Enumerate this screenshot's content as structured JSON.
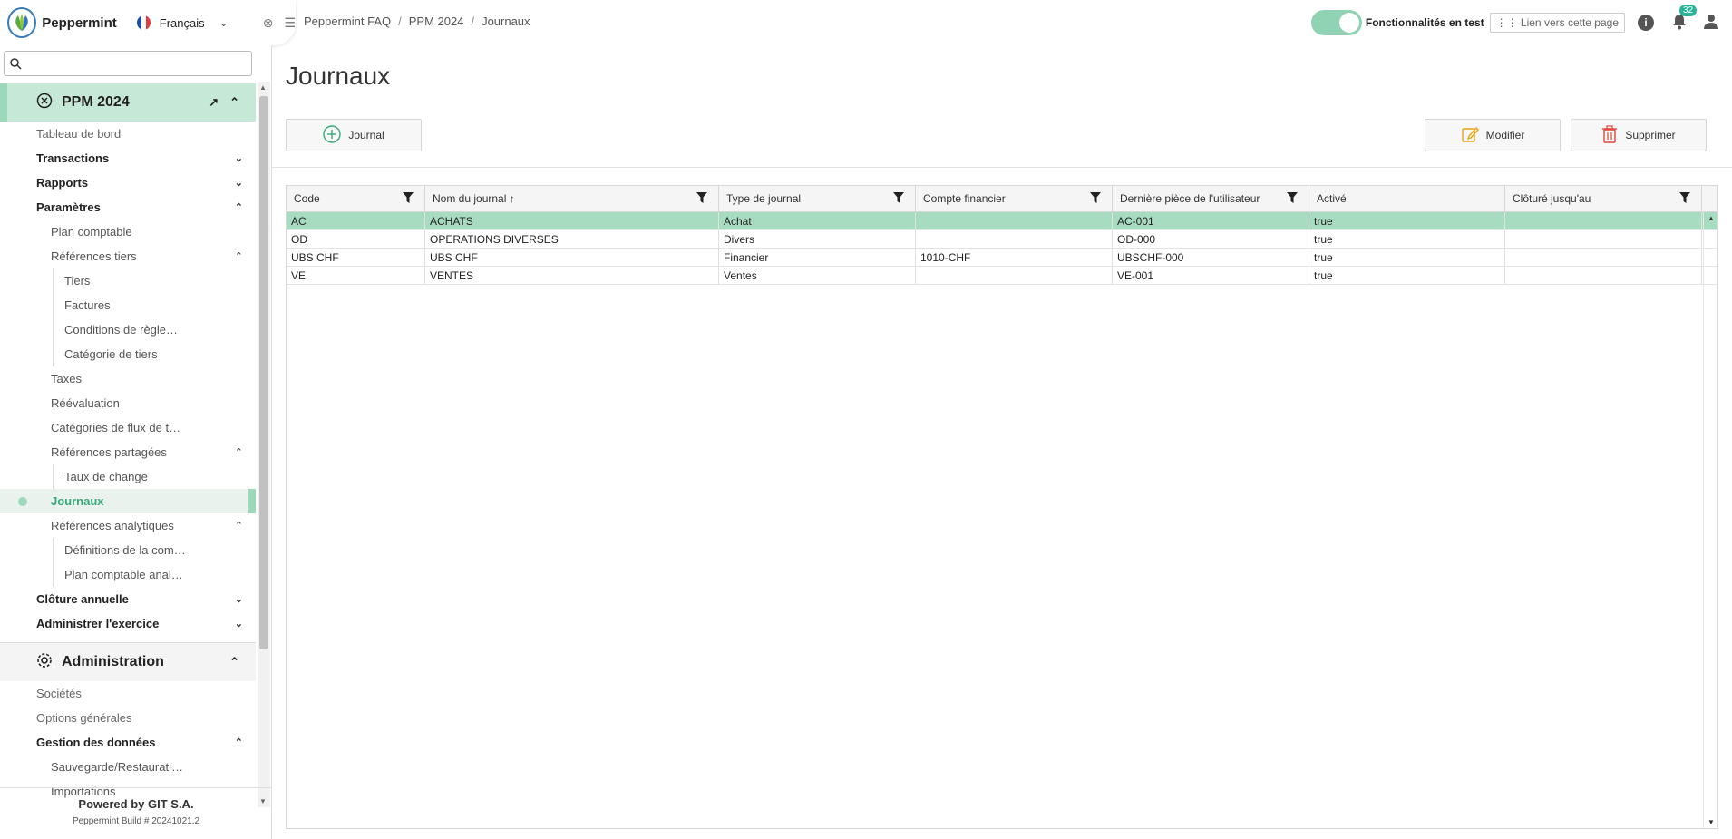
{
  "topbar": {
    "brand": "Peppermint",
    "language": "Français",
    "breadcrumbs": [
      "Peppermint FAQ",
      "PPM 2024",
      "Journaux"
    ],
    "feature_toggle_label": "Fonctionnalités en test",
    "link_button": "Lien vers cette page",
    "info_label": "i",
    "notifications_count": "32"
  },
  "sidebar": {
    "search_placeholder": "",
    "project_title": "PPM 2024",
    "items": [
      {
        "label": "Tableau de bord",
        "level": "l0"
      },
      {
        "label": "Transactions",
        "level": "l1",
        "chev": "down"
      },
      {
        "label": "Rapports",
        "level": "l1",
        "chev": "down"
      },
      {
        "label": "Paramètres",
        "level": "l1",
        "chev": "up"
      },
      {
        "label": "Plan comptable",
        "level": "l2"
      },
      {
        "label": "Références tiers",
        "level": "l2",
        "chev": "up"
      },
      {
        "label": "Tiers",
        "level": "l3"
      },
      {
        "label": "Factures",
        "level": "l3"
      },
      {
        "label": "Conditions de règle…",
        "level": "l3"
      },
      {
        "label": "Catégorie de tiers",
        "level": "l3"
      },
      {
        "label": "Taxes",
        "level": "l2"
      },
      {
        "label": "Réévaluation",
        "level": "l2"
      },
      {
        "label": "Catégories de flux de t…",
        "level": "l2"
      },
      {
        "label": "Références partagées",
        "level": "l2",
        "chev": "up"
      },
      {
        "label": "Taux de change",
        "level": "l3"
      },
      {
        "label": "Journaux",
        "level": "l2",
        "current": true
      },
      {
        "label": "Références analytiques",
        "level": "l2",
        "chev": "up"
      },
      {
        "label": "Définitions de la com…",
        "level": "l3"
      },
      {
        "label": "Plan comptable anal…",
        "level": "l3"
      },
      {
        "label": "Clôture annuelle",
        "level": "l1",
        "chev": "down"
      },
      {
        "label": "Administrer l'exercice",
        "level": "l1",
        "chev": "down"
      }
    ],
    "admin_title": "Administration",
    "admin_items": [
      {
        "label": "Sociétés",
        "level": "l0"
      },
      {
        "label": "Options générales",
        "level": "l0"
      },
      {
        "label": "Gestion des données",
        "level": "l1",
        "chev": "up"
      },
      {
        "label": "Sauvegarde/Restaurati…",
        "level": "l2"
      },
      {
        "label": "Importations",
        "level": "l2"
      }
    ],
    "footer_powered": "Powered by GIT S.A.",
    "footer_build": "Peppermint Build # 20241021.2"
  },
  "main": {
    "title": "Journaux",
    "add_button": "Journal",
    "edit_button": "Modifier",
    "delete_button": "Supprimer",
    "columns": [
      {
        "label": "Code",
        "width": 153,
        "filter": true
      },
      {
        "label": "Nom du journal ↑",
        "width": 324,
        "filter": true
      },
      {
        "label": "Type de journal",
        "width": 217,
        "filter": true
      },
      {
        "label": "Compte financier",
        "width": 217,
        "filter": true
      },
      {
        "label": "Dernière pièce de l'utilisateur",
        "width": 217,
        "filter": true
      },
      {
        "label": "Activé",
        "width": 216,
        "filter": false
      },
      {
        "label": "Clôturé jusqu'au",
        "width": 217,
        "filter": true
      }
    ],
    "rows": [
      [
        "AC",
        "ACHATS",
        "Achat",
        "",
        "AC-001",
        "true",
        ""
      ],
      [
        "OD",
        "OPERATIONS DIVERSES",
        "Divers",
        "",
        "OD-000",
        "true",
        ""
      ],
      [
        "UBS CHF",
        "UBS CHF",
        "Financier",
        "1010-CHF",
        "UBSCHF-000",
        "true",
        ""
      ],
      [
        "VE",
        "VENTES",
        "Ventes",
        "",
        "VE-001",
        "true",
        ""
      ]
    ],
    "selected_row": 0
  },
  "colors": {
    "accent": "#3aa77a",
    "selected_row": "#a7dcc1",
    "active_section": "#c6e8d6",
    "warning_icon": "#e8a317",
    "danger_icon": "#e0443b"
  },
  "icons": {
    "search": "search-icon",
    "close_circle": "close-circle-icon",
    "external_link": "external-link-icon",
    "gear": "gear-icon",
    "filter": "filter-icon",
    "plus": "plus-circle-icon",
    "edit": "edit-icon",
    "trash": "trash-icon",
    "bell": "bell-icon",
    "user": "user-icon"
  }
}
